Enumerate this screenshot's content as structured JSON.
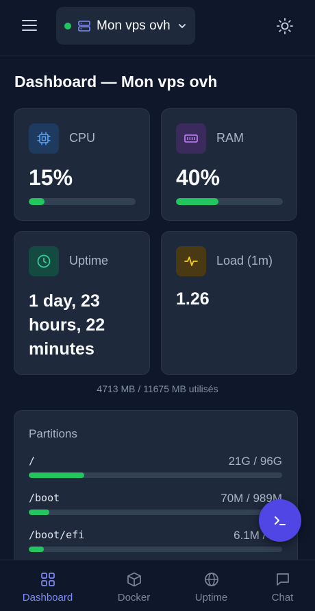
{
  "header": {
    "server_name": "Mon vps ovh",
    "status_color": "#22c55e"
  },
  "page_title": "Dashboard — Mon vps ovh",
  "stats": {
    "cpu": {
      "label": "CPU",
      "value": "15%",
      "percent": 15,
      "icon": "cpu-icon"
    },
    "ram": {
      "label": "RAM",
      "value": "40%",
      "percent": 40,
      "icon": "memory-icon"
    },
    "uptime": {
      "label": "Uptime",
      "value": "1 day, 23 hours, 22 minutes",
      "icon": "clock-icon"
    },
    "load": {
      "label": "Load (1m)",
      "value": "1.26",
      "icon": "activity-icon"
    }
  },
  "memory_note": "4713 MB / 11675 MB utilisés",
  "partitions": {
    "title": "Partitions",
    "items": [
      {
        "mount": "/",
        "usage": "21G / 96G",
        "percent": 22
      },
      {
        "mount": "/boot",
        "usage": "70M / 989M",
        "percent": 8
      },
      {
        "mount": "/boot/efi",
        "usage": "6.1M / 10",
        "percent": 6
      }
    ]
  },
  "nav": {
    "items": [
      {
        "label": "Dashboard",
        "icon": "dashboard-icon",
        "active": true
      },
      {
        "label": "Docker",
        "icon": "box-icon",
        "active": false
      },
      {
        "label": "Uptime",
        "icon": "globe-icon",
        "active": false
      },
      {
        "label": "Chat",
        "icon": "chat-icon",
        "active": false
      }
    ]
  },
  "colors": {
    "accent": "#818cf8",
    "fab": "#4f46e5",
    "success": "#22c55e",
    "background": "#0f172a",
    "card": "#1e293b"
  }
}
